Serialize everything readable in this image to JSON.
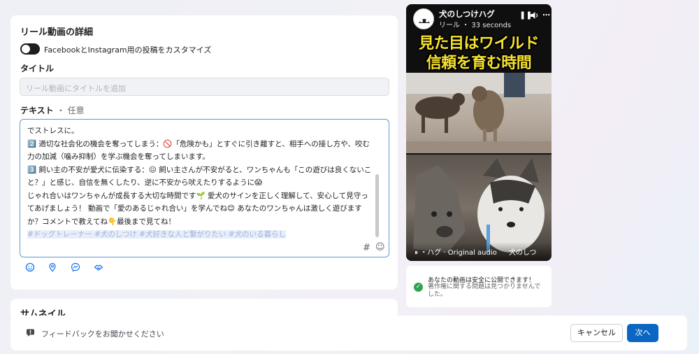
{
  "details": {
    "title": "リール動画の詳細",
    "toggle_label": "FacebookとInstagram用の投稿をカスタマイズ",
    "title_field_label": "タイトル",
    "title_placeholder": "リール動画にタイトルを追加",
    "text_field_label": "テキスト",
    "text_field_optional": "・ 任意",
    "text_lines": [
      "でストレスに。",
      "",
      "2️⃣ 適切な社会化の機会を奪ってしまう：🚫「危険かも」とすぐに引き離すと、相手への接し方や、咬む力の加減（噛み抑制）を学ぶ機会を奪ってしまいます。",
      "",
      "3️⃣ 飼い主の不安が愛犬に伝染する：😖 飼い主さんが不安がると、ワンちゃんも「この遊びは良くないこと？」と感じ、自信を無くしたり、逆に不安から吠えたりするように😱",
      "",
      "じゃれ合いはワンちゃんが成長する大切な時間です🌱 愛犬のサインを正しく理解して、安心して見守ってあげましょう！ 動画で「愛のあるじゃれ合い」を学んでね😊 あなたのワンちゃんは激しく遊びますか？コメントで教えてね👇最後まで見てね！",
      ""
    ],
    "hashtag_line": "#ドッグトレーナー #犬のしつけ #犬好きな人と繋がりたい #犬のいる暮らし"
  },
  "thumbnail": {
    "title": "サムネイル"
  },
  "footer": {
    "feedback_label": "フィードバックをお聞かせください",
    "cancel_label": "キャンセル",
    "next_label": "次へ"
  },
  "preview": {
    "account_name": "犬のしつけハグ",
    "meta": "リール ・ 33 seconds",
    "headline_1": "見た目はワイルド",
    "headline_2": "信頼を育む時間",
    "audio_text": "・ハグ · Original audio",
    "audio_text_2": "犬のしつ",
    "headline_color": "#f7e22e"
  },
  "safety": {
    "title": "あなたの動画は安全に公開できます！",
    "subtitle": "著作権に関する問題は見つかりませんでした。"
  },
  "colors": {
    "accent": "#0a66c2",
    "success": "#31a24c"
  }
}
